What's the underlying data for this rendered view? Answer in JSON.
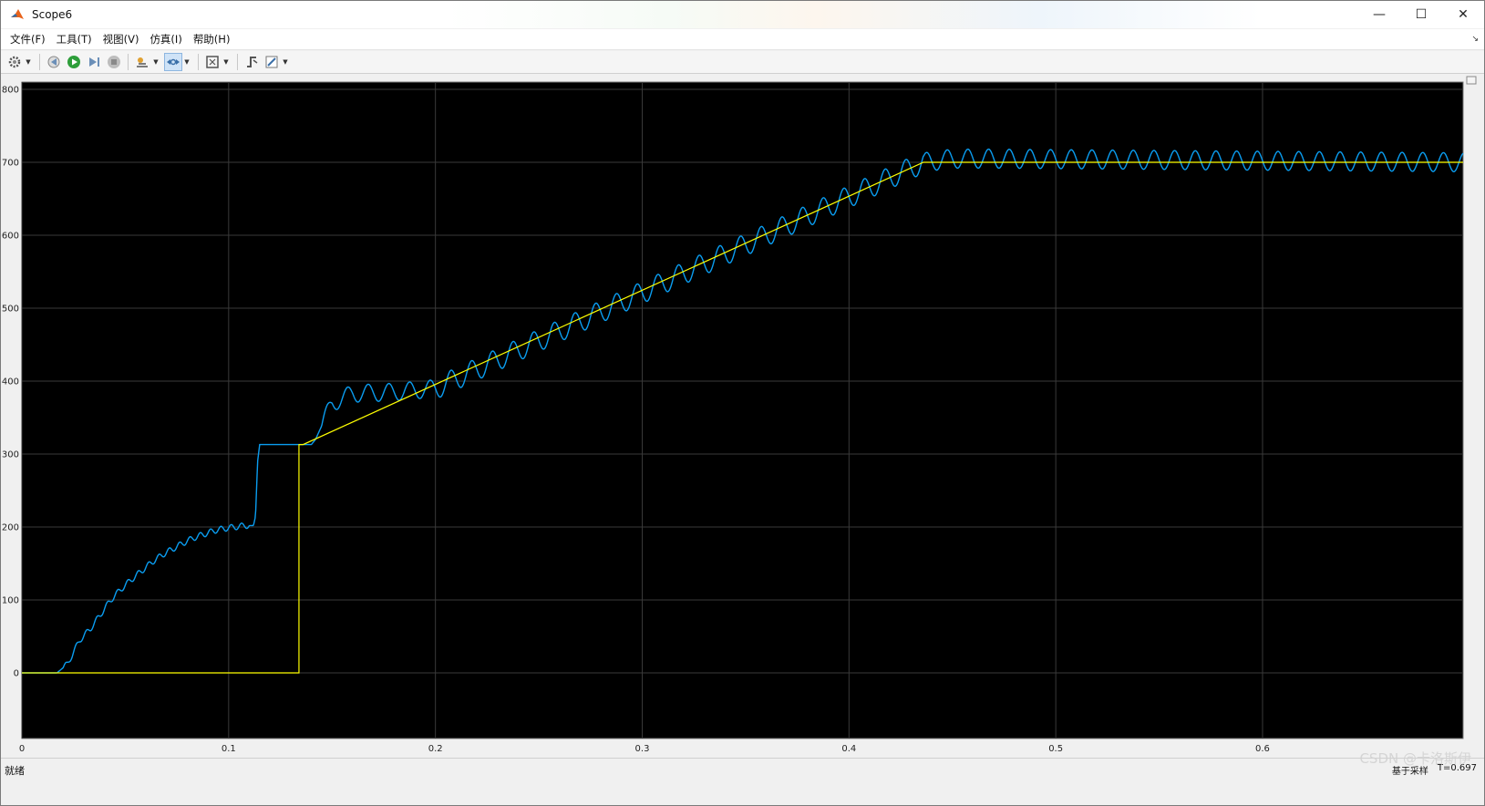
{
  "window": {
    "title": "Scope6",
    "controls": {
      "minimize": "—",
      "maximize": "☐",
      "close": "✕"
    }
  },
  "menu": {
    "items": [
      {
        "label": "文件(F)"
      },
      {
        "label": "工具(T)"
      },
      {
        "label": "视图(V)"
      },
      {
        "label": "仿真(I)"
      },
      {
        "label": "帮助(H)"
      }
    ]
  },
  "toolbar": {
    "icons": [
      "settings-icon",
      "step-back-icon",
      "run-icon",
      "step-forward-icon",
      "stop-icon",
      "highlight-icon",
      "zoom-icon",
      "fit-icon",
      "trigger-icon",
      "style-icon"
    ]
  },
  "status": {
    "left": "就绪",
    "right_sample": "基于采样",
    "right_time": "T=0.697"
  },
  "watermark": "CSDN @卡洛斯伊",
  "chart_data": {
    "type": "line",
    "title": "",
    "xlabel": "",
    "ylabel": "",
    "xlim": [
      0,
      0.697
    ],
    "ylim": [
      -90,
      810
    ],
    "x_ticks": [
      "0",
      "0.1",
      "0.2",
      "0.3",
      "0.4",
      "0.5",
      "0.6"
    ],
    "y_ticks": [
      "0",
      "100",
      "200",
      "300",
      "400",
      "500",
      "600",
      "700",
      "800"
    ],
    "grid": true,
    "background": "#000000",
    "grid_color": "#3a3a3a",
    "series": [
      {
        "color": "#ffff00",
        "x": [
          0,
          0.134,
          0.134,
          0.136,
          0.436,
          0.697
        ],
        "y": [
          0,
          0,
          313,
          313,
          700,
          700
        ]
      },
      {
        "color": "#0a9df0",
        "x": [
          0,
          0.017,
          0.022,
          0.028,
          0.033,
          0.038,
          0.043,
          0.048,
          0.053,
          0.058,
          0.063,
          0.068,
          0.073,
          0.078,
          0.083,
          0.088,
          0.093,
          0.098,
          0.103,
          0.108,
          0.112,
          0.113,
          0.114,
          0.115,
          0.14,
          0.142,
          0.15,
          0.16,
          0.18,
          0.2,
          0.436,
          0.45,
          0.47,
          0.697
        ],
        "y": [
          0,
          0,
          12,
          45,
          60,
          80,
          100,
          115,
          128,
          140,
          152,
          162,
          170,
          178,
          185,
          190,
          195,
          198,
          200,
          202,
          202,
          215,
          290,
          313,
          313,
          320,
          370,
          383,
          385,
          390,
          700,
          705,
          705,
          700
        ]
      }
    ]
  }
}
